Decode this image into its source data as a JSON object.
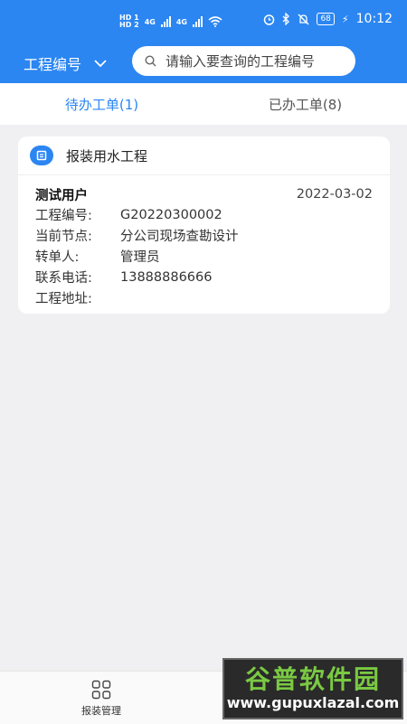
{
  "status_bar": {
    "hd1": "HD 1",
    "hd2": "HD 2",
    "net1": "4G",
    "net2": "4G",
    "battery": "68",
    "time": "10:12"
  },
  "header": {
    "selector_label": "工程编号",
    "search_placeholder": "请输入要查询的工程编号"
  },
  "tabs": [
    {
      "label": "待办工单(1)"
    },
    {
      "label": "已办工单(8)"
    }
  ],
  "card": {
    "title": "报装用水工程",
    "user": "测试用户",
    "date": "2022-03-02",
    "rows": [
      {
        "label": "工程编号:",
        "value": "G20220300002"
      },
      {
        "label": "当前节点:",
        "value": "分公司现场查勘设计"
      },
      {
        "label": "转单人:",
        "value": "管理员"
      },
      {
        "label": "联系电话:",
        "value": "13888886666"
      },
      {
        "label": "工程地址:",
        "value": ""
      }
    ]
  },
  "bottom_nav": {
    "item_label": "报装管理"
  },
  "watermark": {
    "top": "谷普软件园",
    "bottom": "www.gupuxlazal.com"
  },
  "colors": {
    "primary": "#2b86f2",
    "background": "#f0f0f2"
  }
}
